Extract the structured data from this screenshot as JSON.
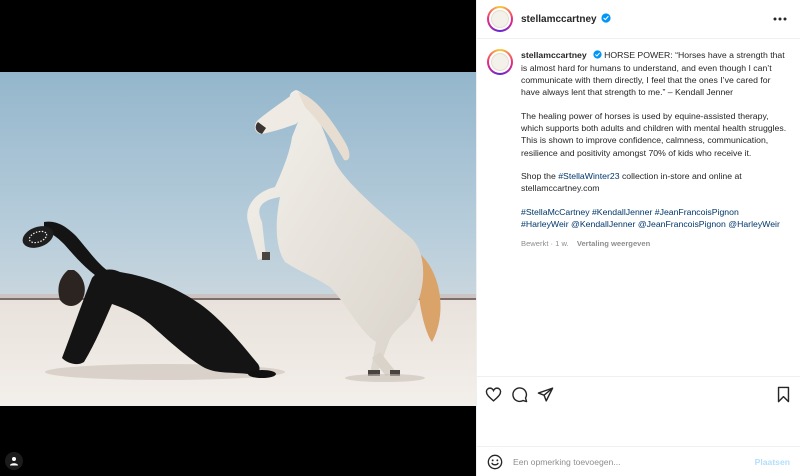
{
  "post": {
    "username": "stellamccartney",
    "caption_user": "stellamccartney",
    "caption_p1": "HORSE POWER: “Horses have a strength that is almost hard for humans to understand, and even though I can’t communicate with them directly, I feel that the ones I’ve cared for have always lent that strength to me.” – Kendall Jenner",
    "caption_p2": "The healing power of horses is used by equine-assisted therapy, which supports both adults and children with mental health struggles. This is shown to improve confidence, calmness, communication, resilience and positivity amongst 70% of kids who receive it.",
    "caption_p3_pre": "Shop the ",
    "caption_p3_tag": "#StellaWinter23",
    "caption_p3_post": " collection in-store and online at stellamccartney.com",
    "hashtags": "#StellaMcCartney #KendallJenner #JeanFrancoisPignon #HarleyWeir @KendallJenner @JeanFrancoisPignon @HarleyWeir",
    "meta_edited": "Bewerkt · 1 w.",
    "meta_translate": "Vertaling weergeven"
  },
  "comment": {
    "placeholder": "Een opmerking toevoegen...",
    "post_label": "Plaatsen"
  },
  "icons": {
    "verified": "verified-badge-icon",
    "more": "more-options-icon",
    "like": "heart-icon",
    "comment": "comment-icon",
    "share": "paper-plane-icon",
    "save": "bookmark-icon",
    "emoji": "smiley-icon",
    "tag": "user-tag-icon"
  },
  "colors": {
    "verified_blue": "#0095f6",
    "link_blue": "#00376b",
    "muted": "#8e8e8e"
  }
}
